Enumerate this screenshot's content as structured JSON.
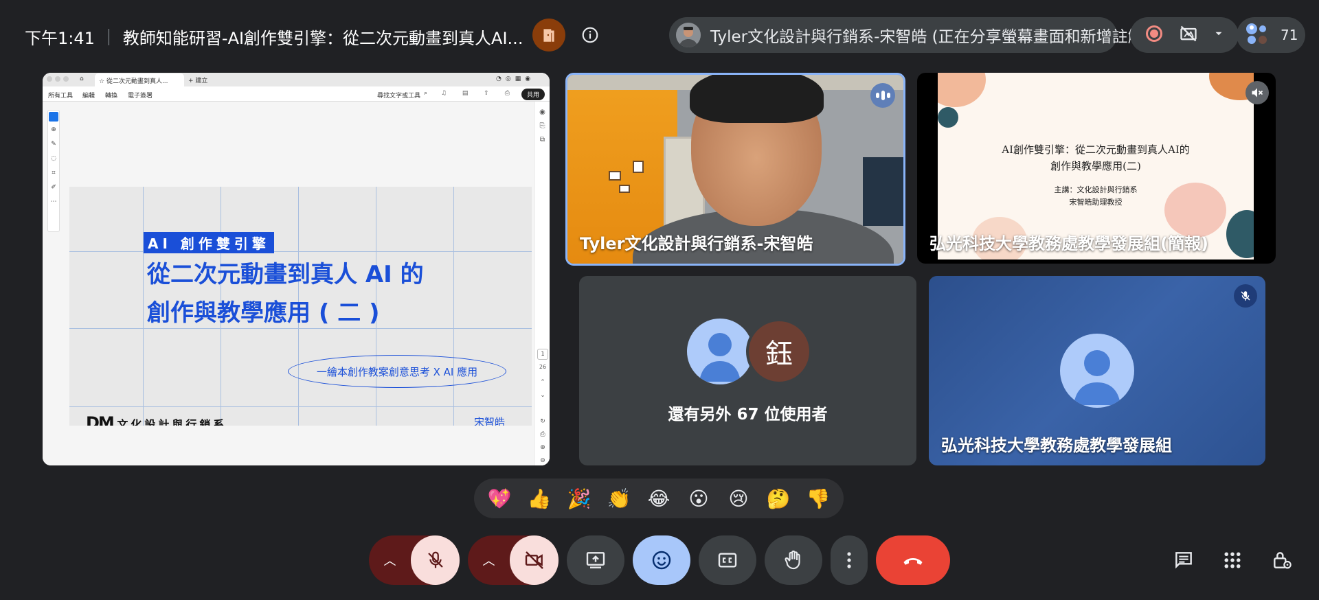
{
  "meeting": {
    "time": "下午1:41",
    "title": "教師知能研習-AI創作雙引擎：從二次元動畫到真人AI..."
  },
  "presenter": {
    "text": "Tyler文化設計與行銷系-宋智皓 (正在分享螢幕畫面和新增註解)"
  },
  "participants": {
    "count": "71"
  },
  "shared_screen": {
    "tab_label": "從二次元動畫到真人...",
    "new_tab_label": "+ 建立",
    "toolbar_items": [
      "所有工具",
      "編輯",
      "轉換",
      "電子簽署"
    ],
    "search_label": "尋找文字或工具",
    "share_button": "共用",
    "page_number": "1",
    "page_total": "26",
    "slide": {
      "kicker": "AI 創作雙引擎",
      "title_line1": "從二次元動畫到真人 AI 的",
      "title_line2": "創作與教學應用 ( 二 )",
      "subtitle": "一繪本創作教案創意思考 X AI 應用",
      "logo_mark": "DM",
      "logo_text": "文化設計與行銷系",
      "author": "宋智皓"
    }
  },
  "tiles": {
    "speaker_name": "Tyler文化設計與行銷系-宋智皓",
    "slidecam_name": "弘光科技大學教務處教學發展組(簡報)",
    "slidecam_title_line1": "AI創作雙引擎：從二次元動畫到真人AI的",
    "slidecam_title_line2": "創作與教學應用(二)",
    "slidecam_sub_line1": "主講：文化設計與行銷系",
    "slidecam_sub_line2": "宋智皓助理教授",
    "others_initial": "鈺",
    "others_text": "還有另外 67 位使用者",
    "hk_name": "弘光科技大學教務處教學發展組"
  },
  "reactions": [
    "💖",
    "👍",
    "🎉",
    "👏",
    "😂",
    "😮",
    "😢",
    "🤔",
    "👎"
  ],
  "colors": {
    "background": "#202124",
    "accent_blue": "#8ab4f8",
    "end_call_red": "#ea4335",
    "slide_blue": "#1a4fd8"
  }
}
